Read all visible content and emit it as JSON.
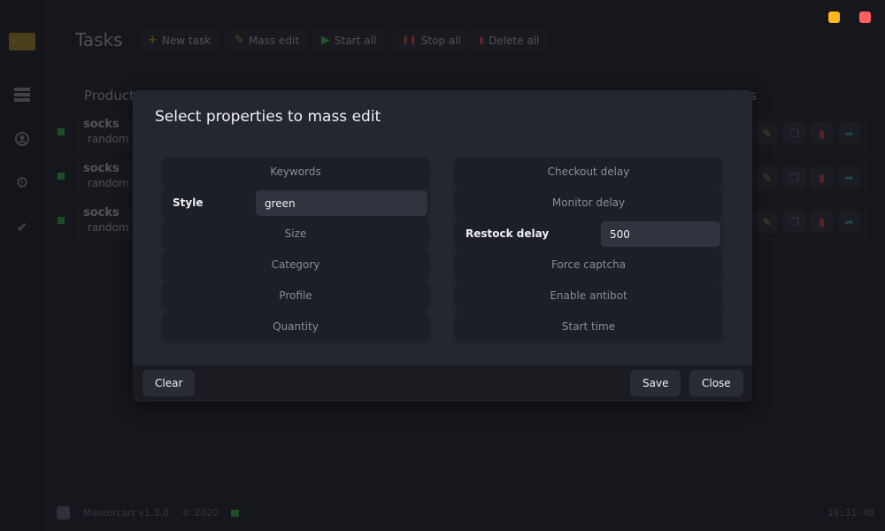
{
  "window": {
    "controls": [
      {
        "name": "minimize",
        "color": "#ffb81c"
      },
      {
        "name": "close",
        "color": "#ff5f5f"
      }
    ]
  },
  "sidebar": {
    "logo_icon": "card-logo-icon",
    "items": [
      {
        "name": "tasks",
        "icon": "server-stack-icon"
      },
      {
        "name": "profiles",
        "icon": "user-circle-icon"
      },
      {
        "name": "settings",
        "icon": "gear-icon"
      },
      {
        "name": "success",
        "icon": "double-check-icon"
      }
    ]
  },
  "header": {
    "title": "Tasks",
    "toolbar": [
      {
        "label": "New task",
        "icon": "plus-icon",
        "glyph": "+",
        "color": "#f0a81c"
      },
      {
        "label": "Mass edit",
        "icon": "pencil-icon",
        "glyph": "✎",
        "color": "#f0a81c"
      },
      {
        "label": "Start all",
        "icon": "play-icon",
        "glyph": "▶",
        "color": "#3fd24f"
      },
      {
        "label": "Stop all",
        "icon": "pause-icon",
        "glyph": "❚❚",
        "color": "#e8403f"
      },
      {
        "label": "Delete all",
        "icon": "trash-icon",
        "glyph": "🗑",
        "color": "#e8403f"
      }
    ]
  },
  "table": {
    "headers": [
      "Product",
      "Actions"
    ],
    "rows": [
      {
        "product": "socks",
        "size": "random",
        "status_color": "#2fbf3f"
      },
      {
        "product": "socks",
        "size": "random",
        "status_color": "#2fbf3f"
      },
      {
        "product": "socks",
        "size": "random",
        "status_color": "#2fbf3f"
      }
    ],
    "row_actions": [
      {
        "name": "edit",
        "icon": "pencil-icon",
        "glyph": "✎",
        "color": "#f0a81c"
      },
      {
        "name": "duplicate",
        "icon": "copy-icon",
        "glyph": "❐",
        "color": "#c03fe0"
      },
      {
        "name": "delete",
        "icon": "trash-icon",
        "glyph": "🗑",
        "color": "#e8403f"
      },
      {
        "name": "export",
        "icon": "file-export-icon",
        "glyph": "➦",
        "color": "#1fc8b8"
      }
    ]
  },
  "footer": {
    "discord_icon": "discord-icon",
    "version": "Mastercart v1.3.0",
    "copyright": "© 2020",
    "status_color": "#2fbf3f",
    "clock": "19:31:48"
  },
  "modal": {
    "title": "Select properties to mass edit",
    "left_fields": [
      {
        "label": "Keywords",
        "active": false
      },
      {
        "label": "Style",
        "active": true,
        "value": "green"
      },
      {
        "label": "Size",
        "active": false
      },
      {
        "label": "Category",
        "active": false
      },
      {
        "label": "Profile",
        "active": false
      },
      {
        "label": "Quantity",
        "active": false
      }
    ],
    "right_fields": [
      {
        "label": "Checkout delay",
        "active": false
      },
      {
        "label": "Monitor delay",
        "active": false
      },
      {
        "label": "Restock delay",
        "active": true,
        "value": "500"
      },
      {
        "label": "Force captcha",
        "active": false
      },
      {
        "label": "Enable antibot",
        "active": false
      },
      {
        "label": "Start time",
        "active": false
      }
    ],
    "buttons": {
      "clear": "Clear",
      "save": "Save",
      "close": "Close"
    }
  }
}
